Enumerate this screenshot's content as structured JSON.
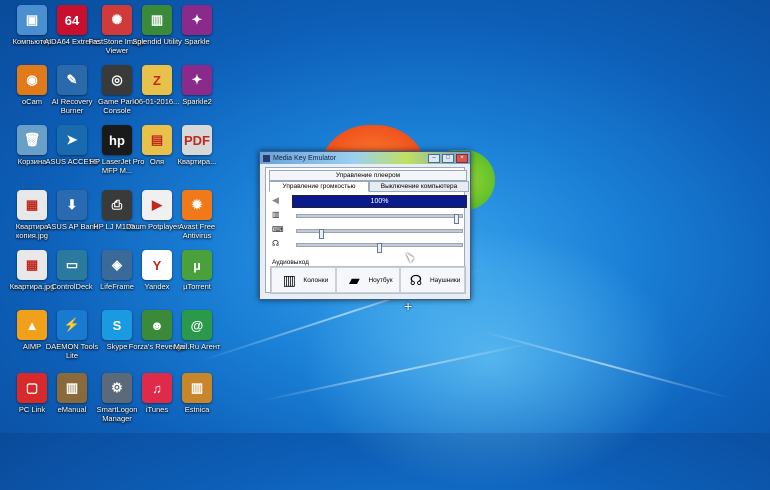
{
  "desktop": {
    "icons": [
      {
        "label": "Компьютер",
        "icon": "computer-icon",
        "color": "#4a90d0",
        "glyph": "▣"
      },
      {
        "label": "AIDA64 Extreme",
        "icon": "aida64-icon",
        "color": "#c8102e",
        "glyph": "64"
      },
      {
        "label": "FastStone Image Viewer",
        "icon": "faststone-icon",
        "color": "#d03a3a",
        "glyph": "✺"
      },
      {
        "label": "Splendid Utility",
        "icon": "splendid-icon",
        "color": "#3a8a3a",
        "glyph": "▥"
      },
      {
        "label": "Sparkle",
        "icon": "sparkle-icon",
        "color": "#8a2a8a",
        "glyph": "✦"
      },
      {
        "label": "oCam",
        "icon": "ocam-icon",
        "color": "#e07a1a",
        "glyph": "◉"
      },
      {
        "label": "AI Recovery Burner",
        "icon": "ai-recovery-icon",
        "color": "#2a6aaa",
        "glyph": "✎"
      },
      {
        "label": "Game Park Console",
        "icon": "game-park-icon",
        "color": "#3a3a3a",
        "glyph": "◎"
      },
      {
        "label": "06-01-2016...",
        "icon": "zip-folder-icon",
        "color": "#e8c14a",
        "glyph": "Z"
      },
      {
        "label": "Sparkle2",
        "icon": "sparkle2-icon",
        "color": "#8a2a8a",
        "glyph": "✦"
      },
      {
        "label": "Корзина",
        "icon": "recycle-bin-icon",
        "color": "#6aa0c8",
        "glyph": "🗑"
      },
      {
        "label": "ASUS ACCESS",
        "icon": "asus-access-icon",
        "color": "#1a6ab0",
        "glyph": "➤"
      },
      {
        "label": "HP LaserJet Pro MFP M...",
        "icon": "hp-icon",
        "color": "#1a1a1a",
        "glyph": "hp"
      },
      {
        "label": "Оля",
        "icon": "folder-icon",
        "color": "#e8c14a",
        "glyph": "▤"
      },
      {
        "label": "Квартира...",
        "icon": "pdf-icon",
        "color": "#d8d8d8",
        "glyph": "PDF"
      },
      {
        "label": "Квартира копия.jpg",
        "icon": "image-file-icon",
        "color": "#e8e8e8",
        "glyph": "▦"
      },
      {
        "label": "ASUS AP Bank",
        "icon": "asus-ap-bank-icon",
        "color": "#2a6ab0",
        "glyph": "⬇"
      },
      {
        "label": "HP LJ M125...",
        "icon": "hp-printer-icon",
        "color": "#3a3a3a",
        "glyph": "⎙"
      },
      {
        "label": "Daum Potplayer ...",
        "icon": "potplayer-icon",
        "color": "#f0f0f0",
        "glyph": "▶"
      },
      {
        "label": "Avast Free Antivirus",
        "icon": "avast-icon",
        "color": "#f07a1a",
        "glyph": "✹"
      },
      {
        "label": "Квартира.jpg",
        "icon": "image-file2-icon",
        "color": "#e8e8e8",
        "glyph": "▦"
      },
      {
        "label": "ControlDeck",
        "icon": "controldeck-icon",
        "color": "#2a7aa0",
        "glyph": "▭"
      },
      {
        "label": "LifeFrame",
        "icon": "lifeframe-icon",
        "color": "#3a6a9a",
        "glyph": "◈"
      },
      {
        "label": "Yandex",
        "icon": "yandex-icon",
        "color": "#ffffff",
        "glyph": "Y"
      },
      {
        "label": "µTorrent",
        "icon": "utorrent-icon",
        "color": "#4aa03a",
        "glyph": "µ"
      },
      {
        "label": "AIMP",
        "icon": "aimp-icon",
        "color": "#f0a01a",
        "glyph": "▲"
      },
      {
        "label": "DAEMON Tools Lite",
        "icon": "daemon-tools-icon",
        "color": "#1a7ad0",
        "glyph": "⚡"
      },
      {
        "label": "Skype",
        "icon": "skype-icon",
        "color": "#1a9ae0",
        "glyph": "S"
      },
      {
        "label": "Forza's Revenge",
        "icon": "forza-icon",
        "color": "#3a8a3a",
        "glyph": "☻"
      },
      {
        "label": "Mail.Ru Агент",
        "icon": "mailru-agent-icon",
        "color": "#2a9a4a",
        "glyph": "@"
      },
      {
        "label": "PC Link",
        "icon": "pc-link-icon",
        "color": "#d82a2a",
        "glyph": "▢"
      },
      {
        "label": "eManual",
        "icon": "emanual-icon",
        "color": "#8a6a3a",
        "glyph": "▥"
      },
      {
        "label": "SmartLogon Manager",
        "icon": "smartlogon-icon",
        "color": "#5a6a7a",
        "glyph": "⚙"
      },
      {
        "label": "iTunes",
        "icon": "itunes-icon",
        "color": "#e02a4a",
        "glyph": "♫"
      },
      {
        "label": "Estnica",
        "icon": "estnica-icon",
        "color": "#c8862a",
        "glyph": "▥"
      }
    ]
  },
  "window": {
    "title": "Media Key Emulator",
    "top_tab": "Управление плеером",
    "tabs": [
      "Управление громкостью",
      "Выключение компьютера"
    ],
    "volume_text": "100%",
    "sliders": [
      {
        "device": "speakers-icon",
        "glyph": "▥",
        "level": 0.98
      },
      {
        "device": "laptop-icon",
        "glyph": "⌨",
        "level": 0.14
      },
      {
        "device": "headphones-icon",
        "glyph": "☊",
        "level": 0.5
      }
    ],
    "audio_output_label": "Аудиовыход",
    "outputs": [
      {
        "label": "Колонки",
        "icon": "speakers-icon",
        "glyph": "▥"
      },
      {
        "label": "Ноутбук",
        "icon": "laptop-icon",
        "glyph": "▰"
      },
      {
        "label": "Наушники",
        "icon": "headphones-icon",
        "glyph": "☊"
      }
    ]
  }
}
